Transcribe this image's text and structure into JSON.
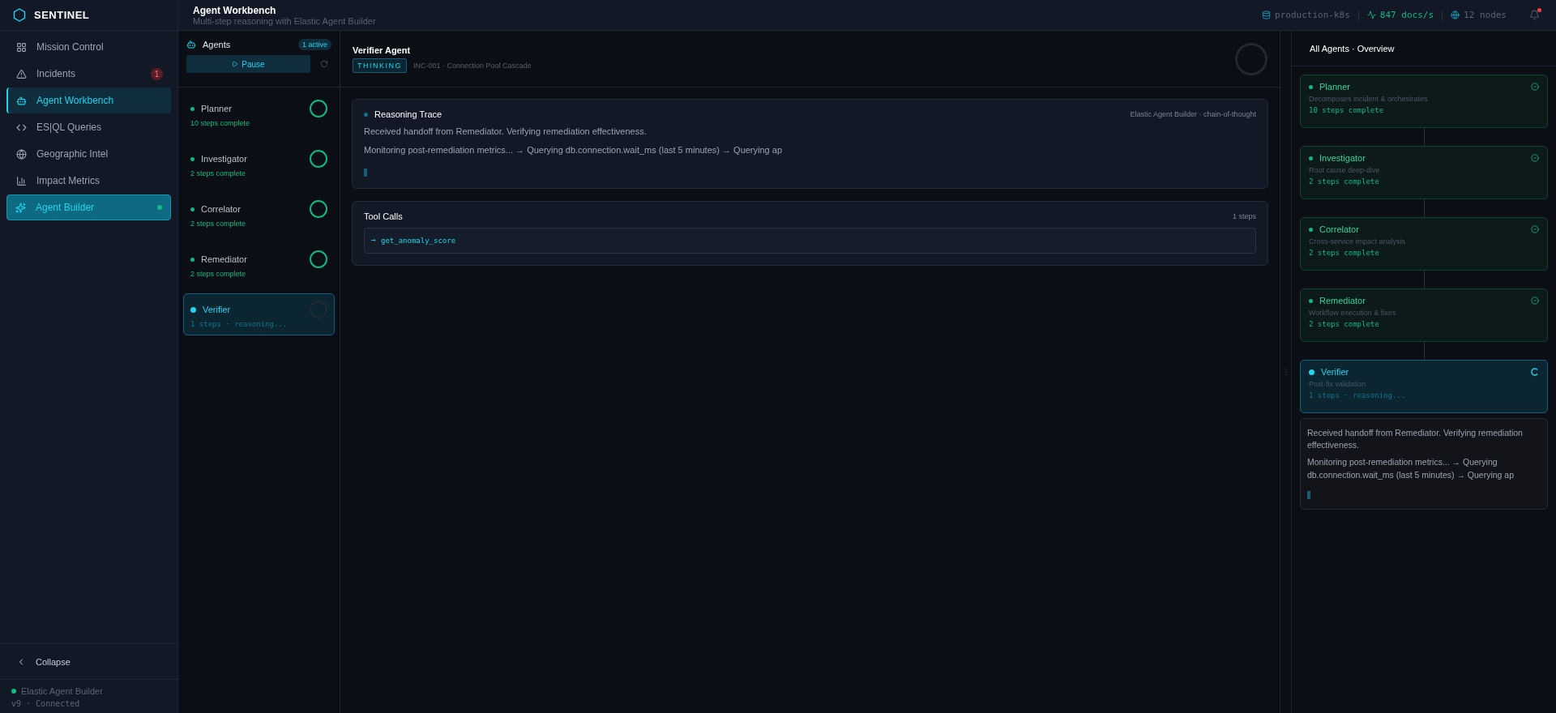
{
  "brand": {
    "name": "SENTINEL"
  },
  "nav": [
    {
      "label": "Mission Control",
      "kind": "link",
      "selected": false
    },
    {
      "label": "Incidents",
      "kind": "link",
      "selected": false,
      "badge": "1"
    },
    {
      "label": "Agent Workbench",
      "kind": "link",
      "selected": true
    },
    {
      "label": "ES|QL Queries",
      "kind": "link",
      "selected": false
    },
    {
      "label": "Geographic Intel",
      "kind": "link",
      "selected": false
    },
    {
      "label": "Impact Metrics",
      "kind": "link",
      "selected": false
    },
    {
      "label": "Agent Builder",
      "kind": "feature",
      "selected": false
    }
  ],
  "sidebar_footer": {
    "collapse": "Collapse",
    "status_name": "Elastic Agent Builder",
    "status_line": "v9 · Connected",
    "connected": true
  },
  "header": {
    "title": "Agent Workbench",
    "subtitle": "Multi-step reasoning with Elastic Agent Builder",
    "cluster": "production-k8s",
    "throughput": "847 docs/s",
    "nodes": "12 nodes",
    "unread": true
  },
  "agents_panel": {
    "title": "Agents",
    "active_count": "1 active",
    "pause_button": "Pause",
    "agents": [
      {
        "name": "Planner",
        "status_text": "10 steps complete",
        "complete": true,
        "selected": false
      },
      {
        "name": "Investigator",
        "status_text": "2 steps complete",
        "complete": true,
        "selected": false
      },
      {
        "name": "Correlator",
        "status_text": "2 steps complete",
        "complete": true,
        "selected": false
      },
      {
        "name": "Remediator",
        "status_text": "2 steps complete",
        "complete": true,
        "selected": false
      },
      {
        "name": "Verifier",
        "status_text": "1 steps · reasoning...",
        "complete": false,
        "selected": true
      }
    ]
  },
  "detail": {
    "title": "Verifier Agent",
    "state": "THINKING",
    "context": "INC-001 · Connection Pool Cascade",
    "reasoning": {
      "title": "Reasoning Trace",
      "source": "Elastic Agent Builder · chain-of-thought",
      "lines": [
        "Received handoff from Remediator. Verifying remediation effectiveness.",
        "Monitoring post-remediation metrics... → Querying db.connection.wait_ms (last 5 minutes) → Querying ap"
      ]
    },
    "tool_calls": {
      "title": "Tool Calls",
      "count": "1 steps",
      "calls": [
        "get_anomaly_score"
      ]
    }
  },
  "overview": {
    "title": "All Agents · Overview",
    "agents": [
      {
        "name": "Planner",
        "description": "Decomposes incident & orchestrates",
        "status_text": "10 steps complete",
        "complete": true
      },
      {
        "name": "Investigator",
        "description": "Root cause deep-dive",
        "status_text": "2 steps complete",
        "complete": true
      },
      {
        "name": "Correlator",
        "description": "Cross-service impact analysis",
        "status_text": "2 steps complete",
        "complete": true
      },
      {
        "name": "Remediator",
        "description": "Workflow execution & fixes",
        "status_text": "2 steps complete",
        "complete": true
      },
      {
        "name": "Verifier",
        "description": "Post-fix validation",
        "status_text": "1 steps · reasoning...",
        "complete": false
      }
    ],
    "trace": [
      "Received handoff from Remediator. Verifying remediation effectiveness.",
      "Monitoring post-remediation metrics... → Querying db.connection.wait_ms (last 5 minutes) → Querying ap"
    ]
  }
}
